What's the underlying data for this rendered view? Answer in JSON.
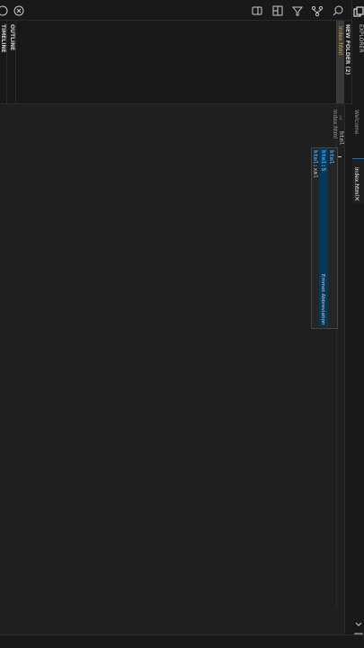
{
  "sidebar": {
    "explorer_title": "EXPLORER",
    "folder_title": "NEW FOLDER (2)",
    "file": "index.html",
    "outline_label": "OUTLINE",
    "timeline_label": "TIMELINE"
  },
  "tabs": [
    {
      "label": "Welcome"
    },
    {
      "label": "index.html"
    }
  ],
  "editor": {
    "breadcrumb": "index.html",
    "line_number": "1",
    "line_text": "html"
  },
  "suggest": {
    "items": [
      {
        "prefix": "",
        "match": "html",
        "suffix": ""
      },
      {
        "prefix": "",
        "match": "html",
        "suffix": ":5"
      },
      {
        "prefix": "",
        "match": "html",
        "suffix": ":xml"
      }
    ],
    "detail": "Emmet Abbreviation"
  },
  "colors": {
    "accent": "#0078d4",
    "selection": "#04395e",
    "match": "#2aaaff",
    "modified_dot": "#e2a24c"
  }
}
